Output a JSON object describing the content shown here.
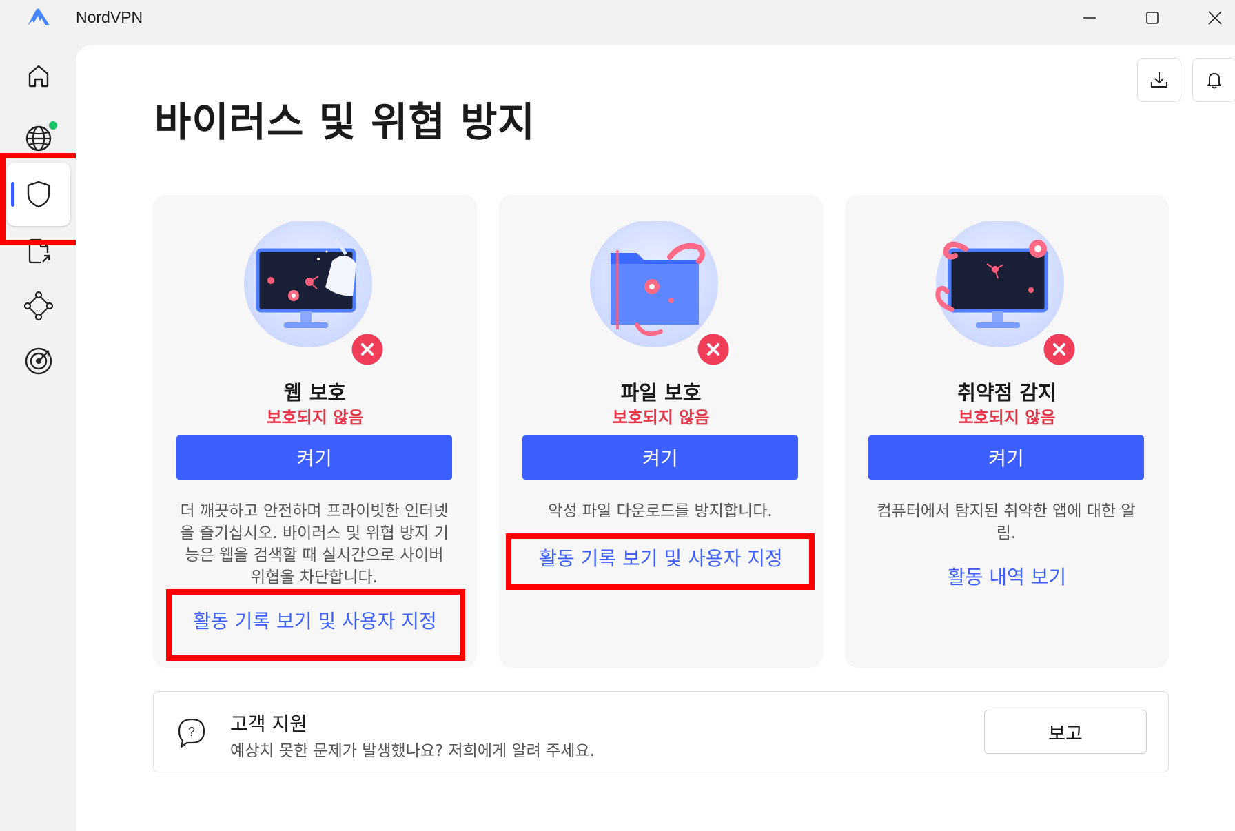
{
  "window": {
    "title": "NordVPN",
    "logo_icon": "nordvpn-mountain-logo",
    "controls": [
      "minimize-icon",
      "maximize-icon",
      "close-icon"
    ]
  },
  "sidebar": {
    "items": [
      {
        "id": "home",
        "icon": "home-icon",
        "active": false
      },
      {
        "id": "vpn-globe",
        "icon": "globe-icon",
        "active": false,
        "status": "connected-dot",
        "status_color": "#18c164"
      },
      {
        "id": "threat-protection",
        "icon": "shield-icon",
        "active": true
      },
      {
        "id": "file-share",
        "icon": "file-share-icon",
        "active": false
      },
      {
        "id": "meshnet",
        "icon": "meshnet-icon",
        "active": false
      },
      {
        "id": "dark-web-monitor",
        "icon": "target-icon",
        "active": false
      }
    ]
  },
  "header": {
    "download_icon": "download-icon",
    "notification_icon": "bell-icon"
  },
  "page": {
    "title": "바이러스 및 위협 방지"
  },
  "cards": [
    {
      "title": "웹 보호",
      "status": "보호되지 않음",
      "button": "켜기",
      "description": "더 깨끗하고 안전하며 프라이빗한 인터넷을 즐기십시오. 바이러스 및 위협 방지 기능은 웹을 검색할 때 실시간으로 사이버 위협을 차단합니다.",
      "link": "활동 기록 보기 및 사용자 지정",
      "illustration": "monitor-broom-illustration"
    },
    {
      "title": "파일 보호",
      "status": "보호되지 않음",
      "button": "켜기",
      "description": "악성 파일 다운로드를 방지합니다.",
      "link": "활동 기록 보기 및 사용자 지정",
      "illustration": "folder-tentacle-illustration"
    },
    {
      "title": "취약점 감지",
      "status": "보호되지 않음",
      "button": "켜기",
      "description": "컴퓨터에서 탐지된 취약한 앱에 대한 알림.",
      "link": "활동 내역 보기",
      "illustration": "monitor-tentacle-illustration"
    }
  ],
  "support": {
    "icon": "question-chat-icon",
    "title": "고객 지원",
    "subtitle": "예상치 못한 문제가 발생했나요? 저희에게 알려 주세요.",
    "button": "보고"
  },
  "colors": {
    "accent": "#3e5fff",
    "status_error": "#e5364a",
    "highlight": "#ff0000"
  }
}
